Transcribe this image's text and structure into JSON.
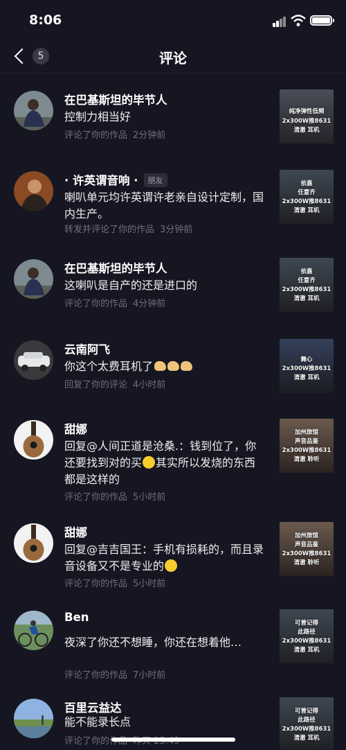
{
  "status": {
    "time": "8:06"
  },
  "nav": {
    "badge": "5",
    "title": "评论"
  },
  "comments": [
    {
      "name": "在巴基斯坦的毕节人",
      "tag": "",
      "text": "控制力相当好",
      "action": "评论了你的作品",
      "ago": "2分钟前",
      "thumb": [
        "纯净弹性低频",
        "2x300W推8631",
        "清澈    耳机"
      ]
    },
    {
      "name": "· 许英谓音响 ·",
      "tag": "朋友",
      "text": "喇叭单元均许英谓许老亲自设计定制，国内生产。",
      "action": "转发并评论了你的作品",
      "ago": "3分钟前",
      "thumb": [
        "依嘉",
        "任意齐",
        "2x300W推8631",
        "清澈    耳机"
      ]
    },
    {
      "name": "在巴基斯坦的毕节人",
      "tag": "",
      "text": "这喇叭是自产的还是进口的",
      "action": "评论了你的作品",
      "ago": "4分钟前",
      "thumb": [
        "依嘉",
        "任意齐",
        "2x300W推8631",
        "清澈    耳机"
      ]
    },
    {
      "name": "云南阿飞",
      "tag": "",
      "text": "你这个太费耳机了",
      "action": "回复了你的评论",
      "ago": "4小时前",
      "thumb": [
        "舞心",
        "2x300W推8631",
        "清澈    耳机"
      ]
    },
    {
      "name": "甜娜",
      "tag": "",
      "text_parts": [
        "回复@人间正道是沧桑.：钱到位了，你还要找到对的买",
        "其实所以发烧的东西都是这样的"
      ],
      "action": "评论了你的作品",
      "ago": "5小时前",
      "thumb": [
        "加州旅馆",
        "声音品鉴",
        "2x300W推8631",
        "清澈    聆听"
      ]
    },
    {
      "name": "甜娜",
      "tag": "",
      "text_parts": [
        "回复@吉吉国王：手机有损耗的，而且录音设备又不是专业的",
        ""
      ],
      "action": "评论了你的作品",
      "ago": "5小时前",
      "thumb": [
        "加州旅馆",
        "声音品鉴",
        "2x300W推8631",
        "清澈    聆听"
      ]
    },
    {
      "name": "Ben",
      "tag": "",
      "text": "夜深了你还不想睡，你还在想着他…",
      "action": "评论了你的作品",
      "ago": "7小时前",
      "thumb": [
        "可曾记得",
        "此路径",
        "2x300W推8631",
        "清澈    耳机"
      ]
    },
    {
      "name": "百里云益达",
      "tag": "",
      "text": "能不能录长点",
      "action": "评论了你的作品",
      "ago": "昨天 23:49",
      "thumb": [
        "可曾记得",
        "此路径",
        "2x300W推8631",
        "清澈    耳机"
      ]
    }
  ]
}
